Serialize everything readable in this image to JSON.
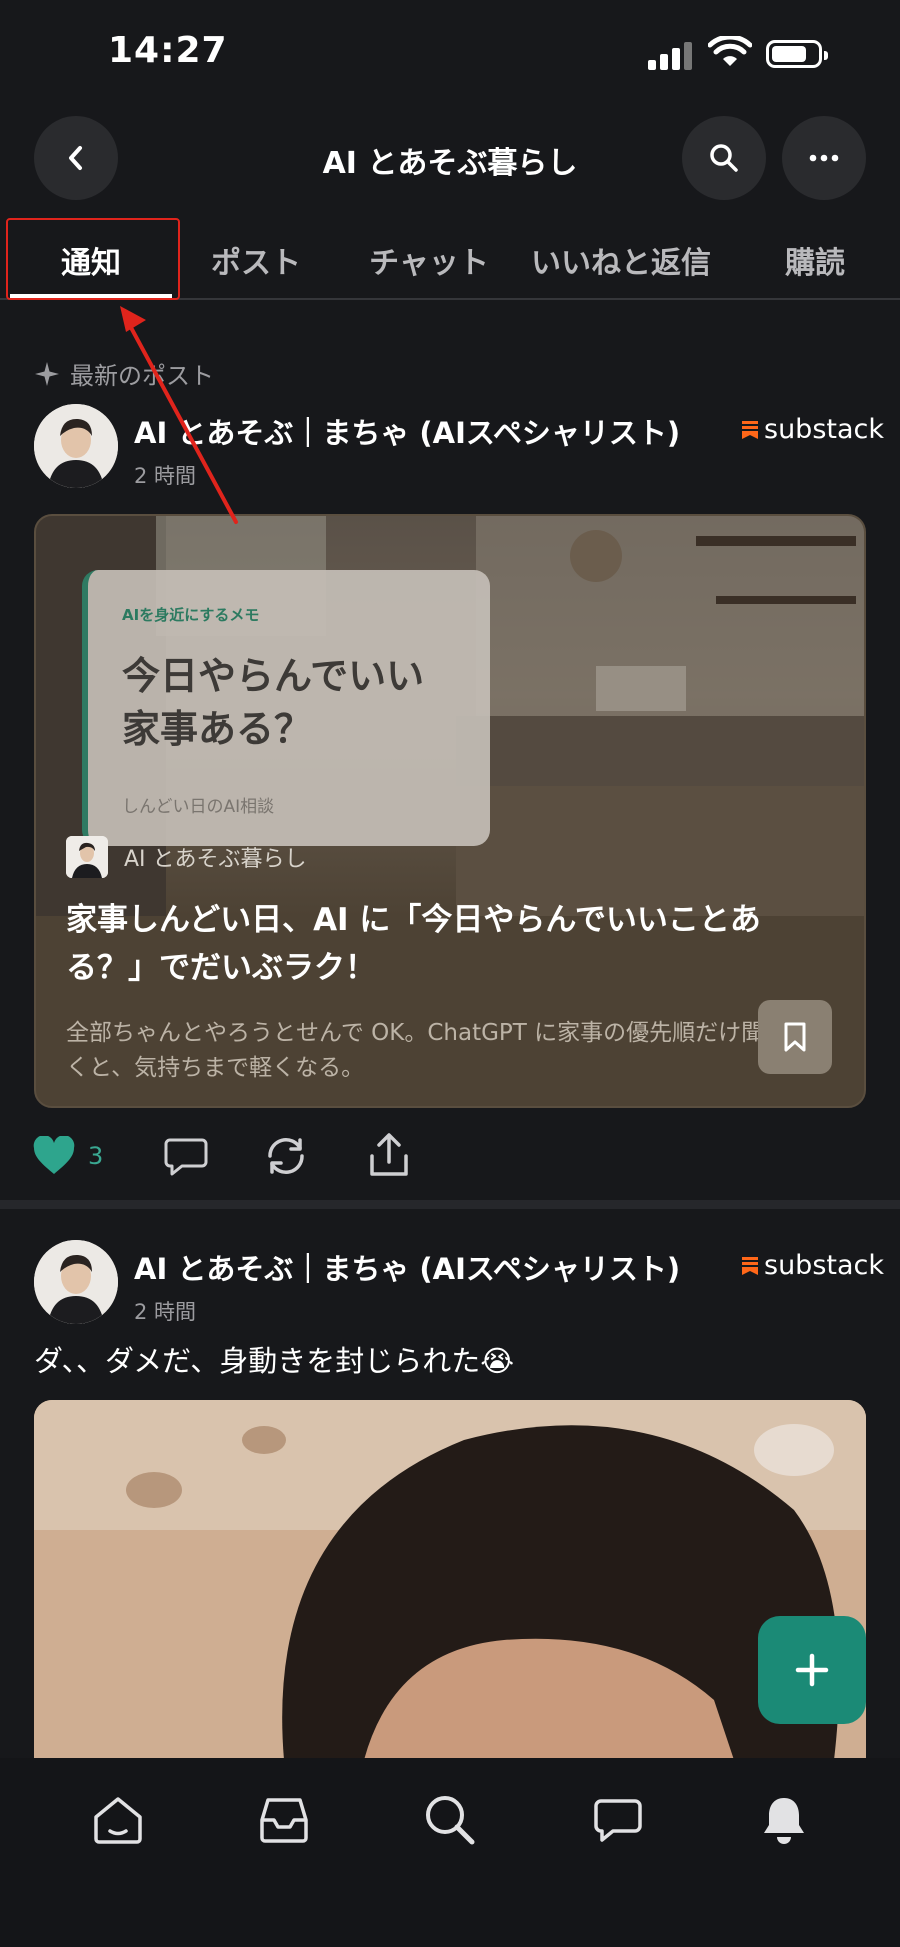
{
  "status_bar": {
    "time": "14:27"
  },
  "header": {
    "title": "AI とあそぶ暮らし"
  },
  "tabs": [
    {
      "label": "通知"
    },
    {
      "label": "ポスト"
    },
    {
      "label": "チャット"
    },
    {
      "label": "いいねと返信"
    },
    {
      "label": "購読"
    }
  ],
  "feed": {
    "section_label": "最新のポスト",
    "posts": [
      {
        "author": "AI とあそぶ｜まちゃ (AIスペシャリスト)",
        "time_ago": "2 時間",
        "source": "substack",
        "card": {
          "note_kicker": "AIを身近にするメモ",
          "note_title": "今日やらんでいい家事ある？",
          "note_sub": "しんどい日のAI相談",
          "publication": "AI とあそぶ暮らし",
          "title": "家事しんどい日、AI に「今日やらんでいいことある？」でだいぶラク！",
          "description": "全部ちゃんとやろうとせんで OK。ChatGPT に家事の優先順だけ聞くと、気持ちまで軽くなる。"
        },
        "likes": "3"
      },
      {
        "author": "AI とあそぶ｜まちゃ (AIスペシャリスト)",
        "time_ago": "2 時間",
        "source": "substack",
        "text": "ダ、、ダメだ、身動きを封じられた😭"
      }
    ]
  },
  "colors": {
    "accent": "#1b8a76",
    "like": "#2ea58d",
    "annotation": "#e0241c",
    "background": "#17181b"
  },
  "icons": {
    "nav": [
      "home-icon",
      "inbox-icon",
      "search-icon",
      "chat-icon",
      "bell-icon"
    ],
    "actions": [
      "heart-icon",
      "comment-icon",
      "restack-icon",
      "share-icon"
    ]
  }
}
